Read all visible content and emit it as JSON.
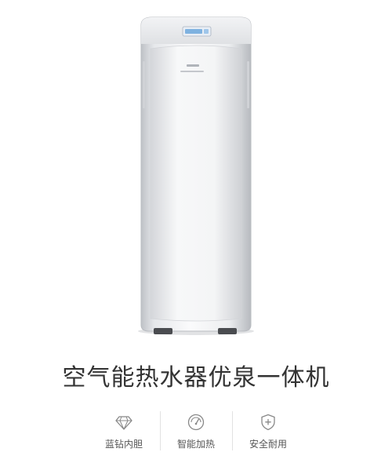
{
  "product": {
    "title": "空气能热水器优泉一体机",
    "image_alt": "空气能热水器优泉一体机",
    "brand_logo": "Midea"
  },
  "features": [
    {
      "label": "蓝钻内胆",
      "icon": "diamond-icon"
    },
    {
      "label": "智能加热",
      "icon": "gauge-icon"
    },
    {
      "label": "安全耐用",
      "icon": "shield-plus-icon"
    }
  ],
  "colors": {
    "body_light": "#f4f5f7",
    "body_shadow": "#c9cbcf",
    "title_text": "#333333",
    "label_text": "#555555",
    "divider": "#e2e2e2",
    "display_blue": "#7fb2e0"
  }
}
